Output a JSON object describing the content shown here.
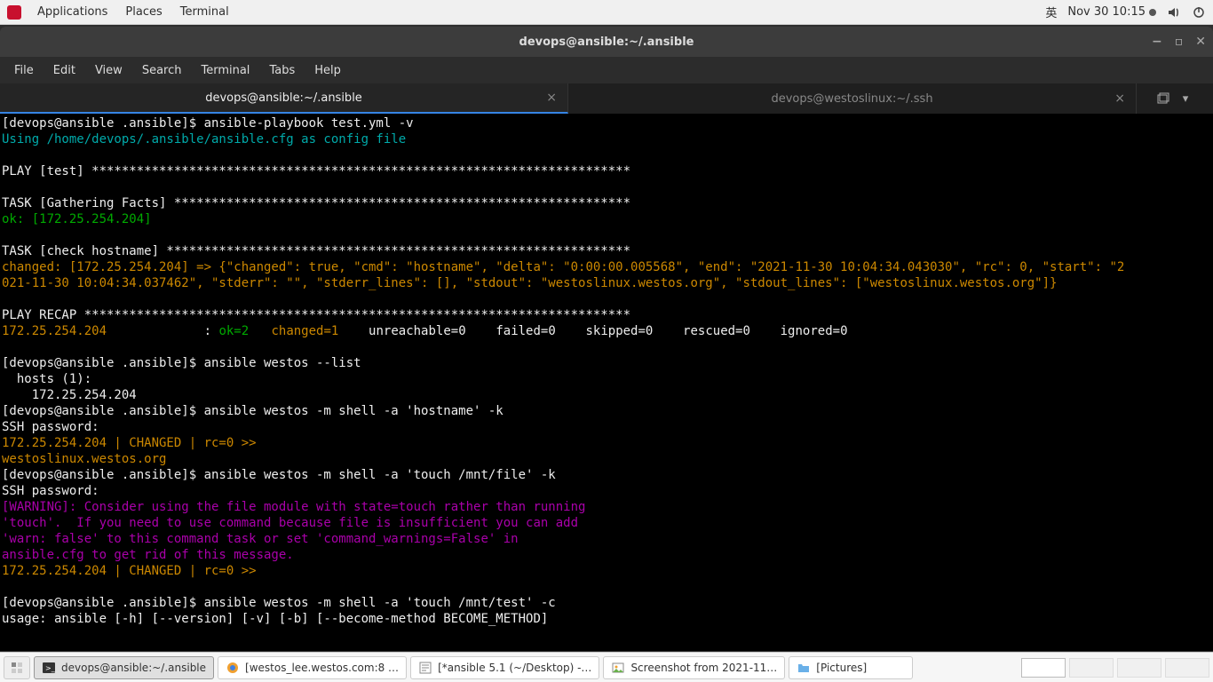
{
  "top_panel": {
    "applications": "Applications",
    "places": "Places",
    "terminal": "Terminal",
    "input_indicator": "英",
    "datetime": "Nov 30  10:15"
  },
  "window": {
    "title": "devops@ansible:~/.ansible"
  },
  "menubar": {
    "file": "File",
    "edit": "Edit",
    "view": "View",
    "search": "Search",
    "terminal": "Terminal",
    "tabs": "Tabs",
    "help": "Help"
  },
  "tabs": {
    "tab1": "devops@ansible:~/.ansible",
    "tab2": "devops@westoslinux:~/.ssh"
  },
  "terminal": {
    "l01": "[devops@ansible .ansible]$ ansible-playbook test.yml -v",
    "l02": "Using /home/devops/.ansible/ansible.cfg as config file",
    "l03": "",
    "l04": "PLAY [test] ************************************************************************",
    "l05": "",
    "l06": "TASK [Gathering Facts] *************************************************************",
    "l07": "ok: [172.25.254.204]",
    "l08": "",
    "l09": "TASK [check hostname] **************************************************************",
    "l10a": "changed: [172.25.254.204] => {\"changed\": true, \"cmd\": \"hostname\", \"delta\": \"0:00:00.005568\", \"end\": \"2021-11-30 10:04:34.043030\", \"rc\": 0, \"start\": \"2",
    "l10b": "021-11-30 10:04:34.037462\", \"stderr\": \"\", \"stderr_lines\": [], \"stdout\": \"westoslinux.westos.org\", \"stdout_lines\": [\"westoslinux.westos.org\"]}",
    "l11": "",
    "l12": "PLAY RECAP *************************************************************************",
    "recap_host": "172.25.254.204",
    "recap_colon": "             : ",
    "recap_ok": "ok=2   ",
    "recap_changed": "changed=1   ",
    "recap_rest": " unreachable=0    failed=0    skipped=0    rescued=0    ignored=0",
    "l14": "",
    "l15": "[devops@ansible .ansible]$ ansible westos --list",
    "l16": "  hosts (1):",
    "l17": "    172.25.254.204",
    "l18": "[devops@ansible .ansible]$ ansible westos -m shell -a 'hostname' -k",
    "l19": "SSH password: ",
    "l20": "172.25.254.204 | CHANGED | rc=0 >>",
    "l21": "westoslinux.westos.org",
    "l22": "[devops@ansible .ansible]$ ansible westos -m shell -a 'touch /mnt/file' -k",
    "l23": "SSH password: ",
    "l24a": "[WARNING]: Consider using the file module with state=touch rather than running",
    "l24b": "'touch'.  If you need to use command because file is insufficient you can add",
    "l24c": "'warn: false' to this command task or set 'command_warnings=False' in",
    "l24d": "ansible.cfg to get rid of this message.",
    "l25": "172.25.254.204 | CHANGED | rc=0 >>",
    "l26": "",
    "l27": "[devops@ansible .ansible]$ ansible westos -m shell -a 'touch /mnt/test' -c",
    "l28": "usage: ansible [-h] [--version] [-v] [-b] [--become-method BECOME_METHOD]"
  },
  "taskbar": {
    "t1": "devops@ansible:~/.ansible",
    "t2": "[westos_lee.westos.com:8 …",
    "t3": "[*ansible 5.1 (~/Desktop) -…",
    "t4": "Screenshot from 2021-11…",
    "t5": "[Pictures]"
  }
}
